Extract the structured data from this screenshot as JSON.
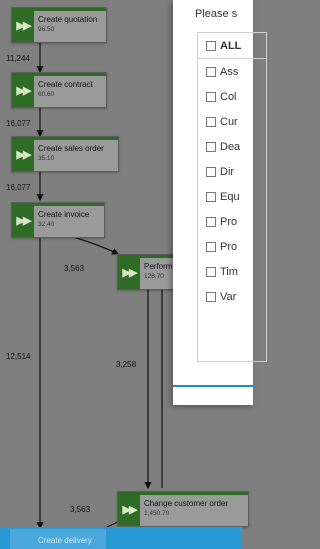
{
  "nodes": [
    {
      "id": "create-quotation",
      "title": "Create quotation",
      "value": "96.50"
    },
    {
      "id": "create-contract",
      "title": "Create contract",
      "value": "60.60"
    },
    {
      "id": "create-sales-order",
      "title": "Create sales order",
      "value": "35.10"
    },
    {
      "id": "create-invoice",
      "title": "Create invoice",
      "value": "32.40"
    },
    {
      "id": "perform",
      "title": "Perform",
      "value": "128.70"
    },
    {
      "id": "change-customer-order",
      "title": "Change customer order",
      "value": "1,450.70"
    },
    {
      "id": "create-delivery",
      "title": "Create delivery",
      "value": ""
    }
  ],
  "edges": {
    "quotation_to_contract": "11,244",
    "contract_to_sales_order": "16,077",
    "sales_order_to_invoice": "16,077",
    "invoice_to_perform": "3,563",
    "invoice_to_delivery": "12,514",
    "perform_to_change": "3,258",
    "change_to_delivery": "3,563"
  },
  "dialog": {
    "prompt": "Please s",
    "header_label": "ALL",
    "items": [
      "Ass",
      "Col",
      "Cur",
      "Dea",
      "Dir",
      "Equ",
      "Pro",
      "Pro",
      "Tim",
      "Var"
    ]
  },
  "colors": {
    "badge": "#2e6b27",
    "accent_blue": "#1a8fd6",
    "overlay": "#7f7f7f"
  }
}
